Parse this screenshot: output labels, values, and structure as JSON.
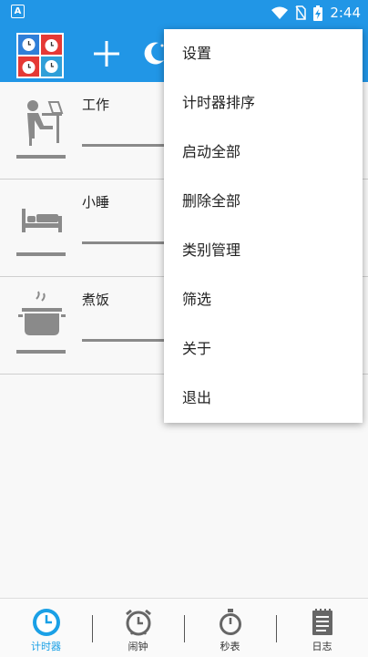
{
  "status_bar": {
    "notification_letter": "A",
    "time": "2:44"
  },
  "toolbar": {
    "add_label": "+",
    "logo_name": "timer-app-logo"
  },
  "timers": [
    {
      "name": "工作",
      "icon": "desk-worker-icon"
    },
    {
      "name": "小睡",
      "icon": "bed-icon"
    },
    {
      "name": "煮饭",
      "icon": "cooking-pot-icon"
    }
  ],
  "menu": {
    "items": [
      "设置",
      "计时器排序",
      "启动全部",
      "删除全部",
      "类别管理",
      "筛选",
      "关于",
      "退出"
    ]
  },
  "bottom_nav": {
    "tabs": [
      {
        "label": "计时器",
        "icon": "timer-icon",
        "active": true
      },
      {
        "label": "闹钟",
        "icon": "alarm-clock-icon",
        "active": false
      },
      {
        "label": "秒表",
        "icon": "stopwatch-icon",
        "active": false
      },
      {
        "label": "日志",
        "icon": "log-notebook-icon",
        "active": false
      }
    ]
  },
  "colors": {
    "primary": "#2196e6",
    "active_tab": "#1aa0e6"
  }
}
